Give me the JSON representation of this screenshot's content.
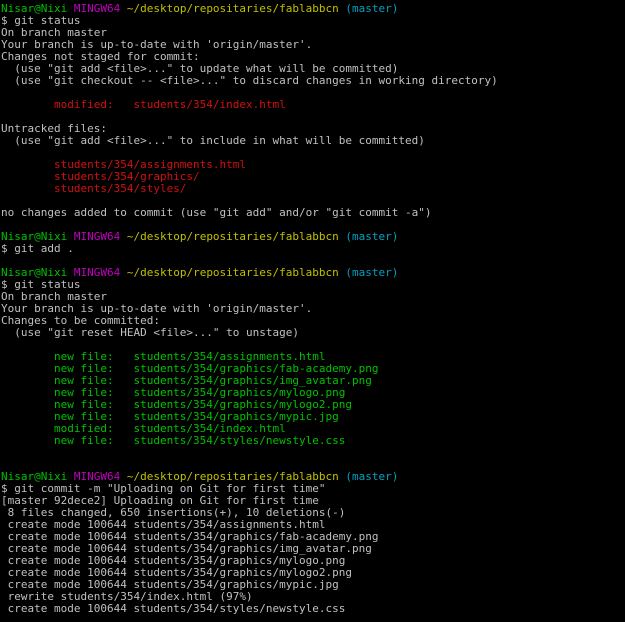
{
  "colors": {
    "background": "#000000",
    "default": "#c0c0c0",
    "green": "#00c000",
    "magenta": "#c000c0",
    "yellow": "#c0c000",
    "cyan": "#00a0c0",
    "red": "#d01010"
  },
  "terminal_lines": [
    {
      "type": "prompt",
      "segs": [
        {
          "t": "Nisar@Nixi ",
          "c": "green"
        },
        {
          "t": "MINGW64 ",
          "c": "magenta"
        },
        {
          "t": "~/desktop/repositaries/fablabbcn ",
          "c": "yellow"
        },
        {
          "t": "(master)",
          "c": "cyan"
        }
      ]
    },
    {
      "type": "command",
      "segs": [
        {
          "t": "$ git status",
          "c": "default"
        }
      ]
    },
    {
      "type": "output",
      "segs": [
        {
          "t": "On branch master",
          "c": "default"
        }
      ]
    },
    {
      "type": "output",
      "segs": [
        {
          "t": "Your branch is up-to-date with 'origin/master'.",
          "c": "default"
        }
      ]
    },
    {
      "type": "output",
      "segs": [
        {
          "t": "Changes not staged for commit:",
          "c": "default"
        }
      ]
    },
    {
      "type": "output",
      "segs": [
        {
          "t": "  (use \"git add <file>...\" to update what will be committed)",
          "c": "default"
        }
      ]
    },
    {
      "type": "output",
      "segs": [
        {
          "t": "  (use \"git checkout -- <file>...\" to discard changes in working directory)",
          "c": "default"
        }
      ]
    },
    {
      "type": "blank",
      "segs": []
    },
    {
      "type": "output",
      "segs": [
        {
          "t": "        modified:   students/354/index.html",
          "c": "red"
        }
      ]
    },
    {
      "type": "blank",
      "segs": []
    },
    {
      "type": "output",
      "segs": [
        {
          "t": "Untracked files:",
          "c": "default"
        }
      ]
    },
    {
      "type": "output",
      "segs": [
        {
          "t": "  (use \"git add <file>...\" to include in what will be committed)",
          "c": "default"
        }
      ]
    },
    {
      "type": "blank",
      "segs": []
    },
    {
      "type": "output",
      "segs": [
        {
          "t": "        students/354/assignments.html",
          "c": "red"
        }
      ]
    },
    {
      "type": "output",
      "segs": [
        {
          "t": "        students/354/graphics/",
          "c": "red"
        }
      ]
    },
    {
      "type": "output",
      "segs": [
        {
          "t": "        students/354/styles/",
          "c": "red"
        }
      ]
    },
    {
      "type": "blank",
      "segs": []
    },
    {
      "type": "output",
      "segs": [
        {
          "t": "no changes added to commit (use \"git add\" and/or \"git commit -a\")",
          "c": "default"
        }
      ]
    },
    {
      "type": "blank",
      "segs": []
    },
    {
      "type": "prompt",
      "segs": [
        {
          "t": "Nisar@Nixi ",
          "c": "green"
        },
        {
          "t": "MINGW64 ",
          "c": "magenta"
        },
        {
          "t": "~/desktop/repositaries/fablabbcn ",
          "c": "yellow"
        },
        {
          "t": "(master)",
          "c": "cyan"
        }
      ]
    },
    {
      "type": "command",
      "segs": [
        {
          "t": "$ git add .",
          "c": "default"
        }
      ]
    },
    {
      "type": "blank",
      "segs": []
    },
    {
      "type": "prompt",
      "segs": [
        {
          "t": "Nisar@Nixi ",
          "c": "green"
        },
        {
          "t": "MINGW64 ",
          "c": "magenta"
        },
        {
          "t": "~/desktop/repositaries/fablabbcn ",
          "c": "yellow"
        },
        {
          "t": "(master)",
          "c": "cyan"
        }
      ]
    },
    {
      "type": "command",
      "segs": [
        {
          "t": "$ git status",
          "c": "default"
        }
      ]
    },
    {
      "type": "output",
      "segs": [
        {
          "t": "On branch master",
          "c": "default"
        }
      ]
    },
    {
      "type": "output",
      "segs": [
        {
          "t": "Your branch is up-to-date with 'origin/master'.",
          "c": "default"
        }
      ]
    },
    {
      "type": "output",
      "segs": [
        {
          "t": "Changes to be committed:",
          "c": "default"
        }
      ]
    },
    {
      "type": "output",
      "segs": [
        {
          "t": "  (use \"git reset HEAD <file>...\" to unstage)",
          "c": "default"
        }
      ]
    },
    {
      "type": "blank",
      "segs": []
    },
    {
      "type": "output",
      "segs": [
        {
          "t": "        new file:   students/354/assignments.html",
          "c": "green"
        }
      ]
    },
    {
      "type": "output",
      "segs": [
        {
          "t": "        new file:   students/354/graphics/fab-academy.png",
          "c": "green"
        }
      ]
    },
    {
      "type": "output",
      "segs": [
        {
          "t": "        new file:   students/354/graphics/img_avatar.png",
          "c": "green"
        }
      ]
    },
    {
      "type": "output",
      "segs": [
        {
          "t": "        new file:   students/354/graphics/mylogo.png",
          "c": "green"
        }
      ]
    },
    {
      "type": "output",
      "segs": [
        {
          "t": "        new file:   students/354/graphics/mylogo2.png",
          "c": "green"
        }
      ]
    },
    {
      "type": "output",
      "segs": [
        {
          "t": "        new file:   students/354/graphics/mypic.jpg",
          "c": "green"
        }
      ]
    },
    {
      "type": "output",
      "segs": [
        {
          "t": "        modified:   students/354/index.html",
          "c": "green"
        }
      ]
    },
    {
      "type": "output",
      "segs": [
        {
          "t": "        new file:   students/354/styles/newstyle.css",
          "c": "green"
        }
      ]
    },
    {
      "type": "blank",
      "segs": []
    },
    {
      "type": "blank",
      "segs": []
    },
    {
      "type": "prompt",
      "segs": [
        {
          "t": "Nisar@Nixi ",
          "c": "green"
        },
        {
          "t": "MINGW64 ",
          "c": "magenta"
        },
        {
          "t": "~/desktop/repositaries/fablabbcn ",
          "c": "yellow"
        },
        {
          "t": "(master)",
          "c": "cyan"
        }
      ]
    },
    {
      "type": "command",
      "segs": [
        {
          "t": "$ git commit -m \"Uploading on Git for first time\"",
          "c": "default"
        }
      ]
    },
    {
      "type": "output",
      "segs": [
        {
          "t": "[master 92dece2] Uploading on Git for first time",
          "c": "default"
        }
      ]
    },
    {
      "type": "output",
      "segs": [
        {
          "t": " 8 files changed, 650 insertions(+), 10 deletions(-)",
          "c": "default"
        }
      ]
    },
    {
      "type": "output",
      "segs": [
        {
          "t": " create mode 100644 students/354/assignments.html",
          "c": "default"
        }
      ]
    },
    {
      "type": "output",
      "segs": [
        {
          "t": " create mode 100644 students/354/graphics/fab-academy.png",
          "c": "default"
        }
      ]
    },
    {
      "type": "output",
      "segs": [
        {
          "t": " create mode 100644 students/354/graphics/img_avatar.png",
          "c": "default"
        }
      ]
    },
    {
      "type": "output",
      "segs": [
        {
          "t": " create mode 100644 students/354/graphics/mylogo.png",
          "c": "default"
        }
      ]
    },
    {
      "type": "output",
      "segs": [
        {
          "t": " create mode 100644 students/354/graphics/mylogo2.png",
          "c": "default"
        }
      ]
    },
    {
      "type": "output",
      "segs": [
        {
          "t": " create mode 100644 students/354/graphics/mypic.jpg",
          "c": "default"
        }
      ]
    },
    {
      "type": "output",
      "segs": [
        {
          "t": " rewrite students/354/index.html (97%)",
          "c": "default"
        }
      ]
    },
    {
      "type": "output",
      "segs": [
        {
          "t": " create mode 100644 students/354/styles/newstyle.css",
          "c": "default"
        }
      ]
    }
  ]
}
